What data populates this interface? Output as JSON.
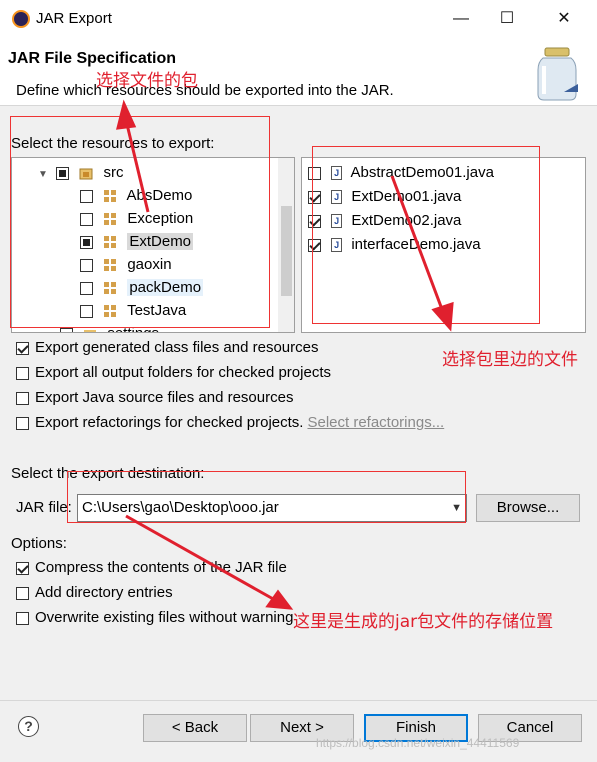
{
  "window": {
    "title": "JAR Export",
    "minimize": "—",
    "maximize": "☐",
    "close": "✕"
  },
  "header": {
    "title": "JAR File Specification",
    "description": "Define which resources should be exported into the JAR."
  },
  "resources": {
    "label": "Select the resources to export:",
    "tree": [
      {
        "label": "src",
        "state": "partial",
        "expanded": true
      },
      {
        "label": "AbsDemo",
        "state": "unchecked"
      },
      {
        "label": "Exception",
        "state": "unchecked"
      },
      {
        "label": "ExtDemo",
        "state": "partial",
        "selected": true
      },
      {
        "label": "gaoxin",
        "state": "unchecked"
      },
      {
        "label": "packDemo",
        "state": "unchecked",
        "highlighted": true
      },
      {
        "label": "TestJava",
        "state": "unchecked"
      },
      {
        "label": "settings",
        "state": "unchecked"
      }
    ],
    "files": [
      {
        "label": "AbstractDemo01.java",
        "checked": false
      },
      {
        "label": "ExtDemo01.java",
        "checked": true
      },
      {
        "label": "ExtDemo02.java",
        "checked": true
      },
      {
        "label": "interfaceDemo.java",
        "checked": true
      }
    ]
  },
  "export_options": [
    {
      "label": "Export generated class files and resources",
      "checked": true
    },
    {
      "label": "Export all output folders for checked projects",
      "checked": false
    },
    {
      "label": "Export Java source files and resources",
      "checked": false
    },
    {
      "label": "Export refactorings for checked projects.",
      "checked": false,
      "link": "Select refactorings..."
    }
  ],
  "destination": {
    "label": "Select the export destination:",
    "jar_file_label": "JAR file:",
    "jar_file_value": "C:\\Users\\gao\\Desktop\\ooo.jar",
    "browse": "Browse..."
  },
  "options": {
    "label": "Options:",
    "items": [
      {
        "label": "Compress the contents of the JAR file",
        "checked": true
      },
      {
        "label": "Add directory entries",
        "checked": false
      },
      {
        "label": "Overwrite existing files without warning",
        "checked": false
      }
    ]
  },
  "buttons": {
    "help": "?",
    "back": "< Back",
    "next": "Next >",
    "finish": "Finish",
    "cancel": "Cancel"
  },
  "annotations": {
    "choose_package": "选择文件的包",
    "choose_files": "选择包里边的文件",
    "jar_location": "这里是生成的jar包文件的存储位置",
    "color": "#e0202e"
  },
  "watermark": "https://blog.csdn.net/weixin_44411569"
}
